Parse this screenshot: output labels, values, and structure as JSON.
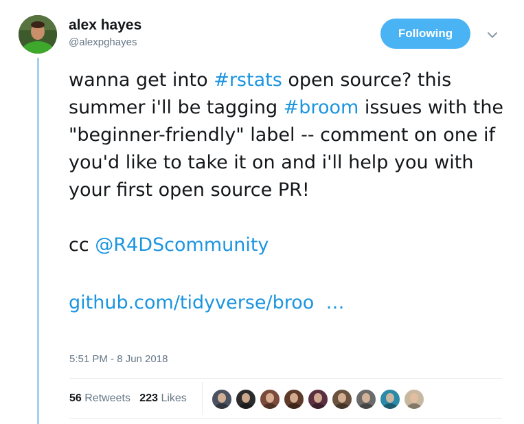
{
  "user": {
    "display_name": "alex hayes",
    "handle": "@alexpghayes"
  },
  "follow_button": {
    "label": "Following",
    "color": "#4ab3f4"
  },
  "tweet": {
    "line1_pre": "wanna get into ",
    "hashtag1": "#rstats",
    "line1_post": " open source? this summer i'll be tagging ",
    "hashtag2": "#broom",
    "line1_tail": " issues with the \"beginner-friendly\" label -- comment on one if you'd like to take it on and i'll help you with your first open source PR!",
    "cc_prefix": "cc ",
    "mention": "@R4DScommunity",
    "url_text": "github.com/tidyverse/broo",
    "url_ellipsis": "…"
  },
  "timestamp": "5:51 PM - 8 Jun 2018",
  "stats": {
    "retweets_count": "56",
    "retweets_label": "Retweets",
    "likes_count": "223",
    "likes_label": "Likes"
  },
  "colors": {
    "link": "#1b95e0",
    "thread_line": "#a3d0f4",
    "muted": "#657786"
  },
  "icons": {
    "caret": "chevron-down-icon"
  },
  "likers": [
    {
      "name": "liker-avatar-1",
      "bg": "#4a5160"
    },
    {
      "name": "liker-avatar-2",
      "bg": "#2b2b2b"
    },
    {
      "name": "liker-avatar-3",
      "bg": "#7a4a3a"
    },
    {
      "name": "liker-avatar-4",
      "bg": "#5e3a2a"
    },
    {
      "name": "liker-avatar-5",
      "bg": "#5a3040"
    },
    {
      "name": "liker-avatar-6",
      "bg": "#6a5240"
    },
    {
      "name": "liker-avatar-7",
      "bg": "#6b6b6b"
    },
    {
      "name": "liker-avatar-8",
      "bg": "#2b8aa8"
    },
    {
      "name": "liker-avatar-9",
      "bg": "#c9b8a0"
    }
  ]
}
